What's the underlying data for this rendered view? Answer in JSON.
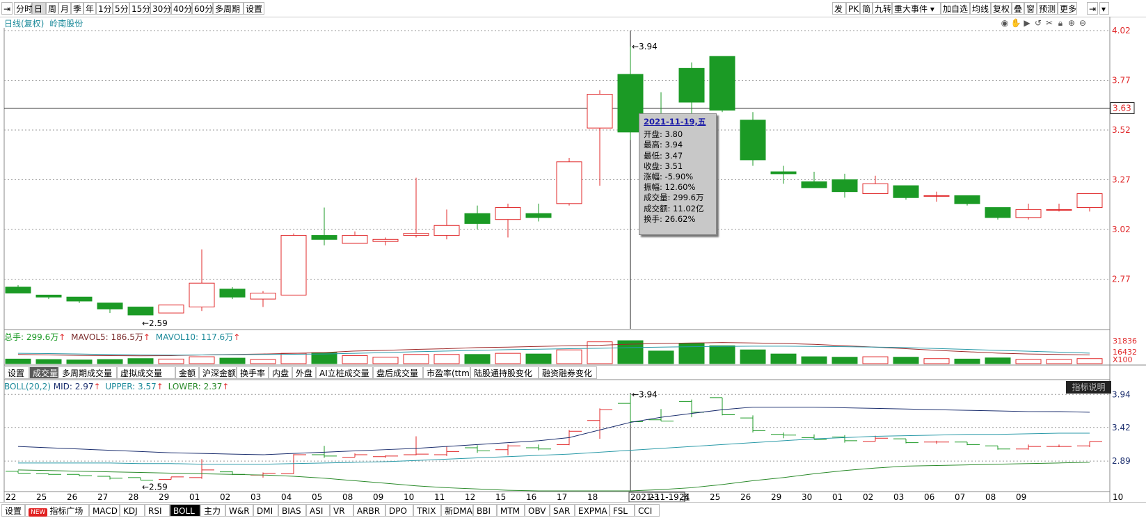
{
  "toolbar": {
    "left": [
      "分时",
      "日",
      "周",
      "月",
      "季",
      "年",
      "1分",
      "5分",
      "15分",
      "30分",
      "40分",
      "60分",
      "多周期",
      "设置"
    ],
    "active": "日",
    "right": [
      "发",
      "PK",
      "简",
      "九转",
      "重大事件",
      "加自选",
      "均线",
      "复权",
      "叠",
      "窗",
      "预测",
      "更多"
    ]
  },
  "main_title": "日线(复权)",
  "stock_name": "岭南股份",
  "icons": [
    "eye-icon",
    "hand-icon",
    "play-icon",
    "undo-icon",
    "scissors-icon",
    "lock-icon",
    "zoom-in-icon",
    "zoom-out-icon"
  ],
  "colors": {
    "up": "#e0282a",
    "down": "#1b9a25",
    "price_axis": "#e0282a",
    "mid": "#1b2e6e",
    "upper": "#2a9aa8",
    "lower": "#2a8a2a",
    "legend_teal": "#1c8a9a"
  },
  "crosshair_value": "3.63",
  "tooltip": {
    "date": "2021-11-19,",
    "weekday": "五",
    "lines": [
      "开盘: 3.80",
      "最高: 3.94",
      "最低: 3.47",
      "收盘: 3.51",
      "涨幅: -5.90%",
      "振幅: 12.60%",
      "成交量: 299.6万",
      "成交额: 11.02亿",
      "换手: 26.62%"
    ]
  },
  "volume_legend": {
    "total": "总手: 299.6万",
    "ma5": "MAVOL5: 186.5万",
    "ma10": "MAVOL10: 117.6万"
  },
  "volume_axis": [
    "31836",
    "16432",
    "X100"
  ],
  "indicator_tabs": [
    "设置",
    "成交量",
    "多周期成交量",
    "虚拟成交量",
    "金额",
    "沪深金额",
    "换手率",
    "内盘",
    "外盘",
    "AI立桩成交量",
    "盘后成交量",
    "市盈率(ttm)",
    "陆股通持股变化",
    "融资融券变化"
  ],
  "indicator_tabs_active": "成交量",
  "boll_legend": {
    "name": "BOLL(20,2)",
    "mid": "MID: 2.97",
    "upper": "UPPER: 3.57",
    "lower": "LOWER: 2.37"
  },
  "note_button": "指标说明",
  "x_labels": [
    "22",
    "25",
    "26",
    "27",
    "28",
    "29",
    "01",
    "02",
    "03",
    "04",
    "05",
    "08",
    "09",
    "10",
    "11",
    "12",
    "15",
    "16",
    "17",
    "18",
    "2021-11-19,五",
    "23",
    "24",
    "25",
    "26",
    "29",
    "30",
    "01",
    "02",
    "03",
    "06",
    "07",
    "08",
    "09",
    "10"
  ],
  "bottom_tabs": [
    "设置",
    "指标广场",
    "MACD",
    "KDJ",
    "RSI",
    "BOLL",
    "主力",
    "W&R",
    "DMI",
    "BIAS",
    "ASI",
    "VR",
    "ARBR",
    "DPO",
    "TRIX",
    "新DMA",
    "BBI",
    "MTM",
    "OBV",
    "SAR",
    "EXPMA",
    "FSL",
    "CCI"
  ],
  "bottom_new_badge": "NEW",
  "bottom_active": "BOLL",
  "chart_data": {
    "type": "candlestick",
    "title": "日线(复权) 岭南股份",
    "candles": [
      {
        "o": 2.73,
        "h": 2.74,
        "l": 2.7,
        "c": 2.7
      },
      {
        "o": 2.69,
        "h": 2.69,
        "l": 2.67,
        "c": 2.68
      },
      {
        "o": 2.68,
        "h": 2.68,
        "l": 2.65,
        "c": 2.66
      },
      {
        "o": 2.65,
        "h": 2.65,
        "l": 2.6,
        "c": 2.62
      },
      {
        "o": 2.63,
        "h": 2.63,
        "l": 2.59,
        "c": 2.59
      },
      {
        "o": 2.6,
        "h": 2.64,
        "l": 2.6,
        "c": 2.64
      },
      {
        "o": 2.63,
        "h": 2.92,
        "l": 2.61,
        "c": 2.75
      },
      {
        "o": 2.72,
        "h": 2.73,
        "l": 2.67,
        "c": 2.68
      },
      {
        "o": 2.67,
        "h": 2.71,
        "l": 2.63,
        "c": 2.7
      },
      {
        "o": 2.69,
        "h": 3.0,
        "l": 2.69,
        "c": 2.99
      },
      {
        "o": 2.99,
        "h": 3.13,
        "l": 2.94,
        "c": 2.97
      },
      {
        "o": 2.95,
        "h": 3.01,
        "l": 2.95,
        "c": 2.99
      },
      {
        "o": 2.96,
        "h": 2.98,
        "l": 2.94,
        "c": 2.97
      },
      {
        "o": 2.99,
        "h": 3.28,
        "l": 2.98,
        "c": 3.0
      },
      {
        "o": 2.99,
        "h": 3.12,
        "l": 2.97,
        "c": 3.04
      },
      {
        "o": 3.1,
        "h": 3.14,
        "l": 3.02,
        "c": 3.05
      },
      {
        "o": 3.07,
        "h": 3.15,
        "l": 2.98,
        "c": 3.13
      },
      {
        "o": 3.1,
        "h": 3.15,
        "l": 3.06,
        "c": 3.08
      },
      {
        "o": 3.15,
        "h": 3.38,
        "l": 3.14,
        "c": 3.36
      },
      {
        "o": 3.53,
        "h": 3.72,
        "l": 3.24,
        "c": 3.7
      },
      {
        "o": 3.8,
        "h": 3.94,
        "l": 3.47,
        "c": 3.51
      },
      {
        "o": 3.54,
        "h": 3.71,
        "l": 3.52,
        "c": 3.52
      },
      {
        "o": 3.83,
        "h": 3.86,
        "l": 3.58,
        "c": 3.66
      },
      {
        "o": 3.89,
        "h": 3.89,
        "l": 3.61,
        "c": 3.62
      },
      {
        "o": 3.57,
        "h": 3.61,
        "l": 3.34,
        "c": 3.37
      },
      {
        "o": 3.31,
        "h": 3.34,
        "l": 3.25,
        "c": 3.3
      },
      {
        "o": 3.26,
        "h": 3.31,
        "l": 3.23,
        "c": 3.23
      },
      {
        "o": 3.27,
        "h": 3.3,
        "l": 3.18,
        "c": 3.21
      },
      {
        "o": 3.2,
        "h": 3.29,
        "l": 3.2,
        "c": 3.25
      },
      {
        "o": 3.24,
        "h": 3.24,
        "l": 3.17,
        "c": 3.18
      },
      {
        "o": 3.19,
        "h": 3.21,
        "l": 3.16,
        "c": 3.19
      },
      {
        "o": 3.19,
        "h": 3.19,
        "l": 3.14,
        "c": 3.15
      },
      {
        "o": 3.13,
        "h": 3.13,
        "l": 3.07,
        "c": 3.08
      },
      {
        "o": 3.08,
        "h": 3.15,
        "l": 3.07,
        "c": 3.12
      },
      {
        "o": 3.12,
        "h": 3.15,
        "l": 3.11,
        "c": 3.12
      },
      {
        "o": 3.13,
        "h": 3.2,
        "l": 3.11,
        "c": 3.2
      }
    ],
    "price_ticks": [
      4.02,
      3.77,
      3.52,
      3.27,
      3.02,
      2.77
    ],
    "ylim": [
      2.52,
      4.02
    ],
    "annotations": {
      "high": "3.94",
      "low": "2.59"
    },
    "volume_ma_lines": {
      "ma5": [
        40,
        38,
        36,
        35,
        34,
        35,
        38,
        40,
        42,
        45,
        48,
        55,
        58,
        62,
        65,
        70,
        72,
        75,
        78,
        80,
        85,
        88,
        90,
        92,
        90,
        88,
        84,
        78,
        72,
        65,
        58,
        52,
        46,
        42,
        40,
        38
      ],
      "ma10": [
        45,
        44,
        42,
        40,
        38,
        37,
        38,
        39,
        40,
        41,
        42,
        45,
        48,
        52,
        55,
        58,
        61,
        63,
        65,
        67,
        70,
        72,
        74,
        75,
        76,
        76,
        75,
        74,
        72,
        70,
        66,
        62,
        58,
        54,
        50,
        46
      ]
    },
    "volumes": [
      20,
      18,
      16,
      18,
      22,
      20,
      30,
      24,
      18,
      45,
      48,
      35,
      28,
      40,
      40,
      40,
      45,
      42,
      60,
      95,
      100,
      55,
      88,
      78,
      60,
      42,
      30,
      28,
      30,
      28,
      22,
      20,
      25,
      18,
      18,
      22
    ],
    "boll": {
      "ticks": [
        3.94,
        3.42,
        2.89
      ],
      "ylim": [
        2.42,
        4.02
      ],
      "mid": [
        3.12,
        3.1,
        3.08,
        3.06,
        3.04,
        3.02,
        3.01,
        3.0,
        2.99,
        3.01,
        3.03,
        3.05,
        3.07,
        3.09,
        3.12,
        3.15,
        3.18,
        3.21,
        3.26,
        3.38,
        3.5,
        3.58,
        3.64,
        3.7,
        3.74,
        3.74,
        3.74,
        3.73,
        3.72,
        3.71,
        3.7,
        3.69,
        3.68,
        3.67,
        3.67,
        3.66
      ],
      "upper": [
        2.86,
        2.86,
        2.86,
        2.86,
        2.85,
        2.85,
        2.84,
        2.84,
        2.84,
        2.85,
        2.86,
        2.87,
        2.88,
        2.9,
        2.92,
        2.94,
        2.96,
        2.98,
        3.0,
        3.03,
        3.06,
        3.09,
        3.12,
        3.15,
        3.18,
        3.21,
        3.24,
        3.26,
        3.28,
        3.29,
        3.3,
        3.31,
        3.31,
        3.32,
        3.33,
        3.33
      ],
      "lower": [
        2.75,
        2.74,
        2.73,
        2.72,
        2.71,
        2.7,
        2.69,
        2.68,
        2.67,
        2.65,
        2.62,
        2.58,
        2.54,
        2.5,
        2.47,
        2.45,
        2.43,
        2.42,
        2.42,
        2.42,
        2.42,
        2.44,
        2.47,
        2.52,
        2.58,
        2.63,
        2.69,
        2.74,
        2.78,
        2.81,
        2.82,
        2.83,
        2.84,
        2.85,
        2.86,
        2.87
      ]
    }
  }
}
